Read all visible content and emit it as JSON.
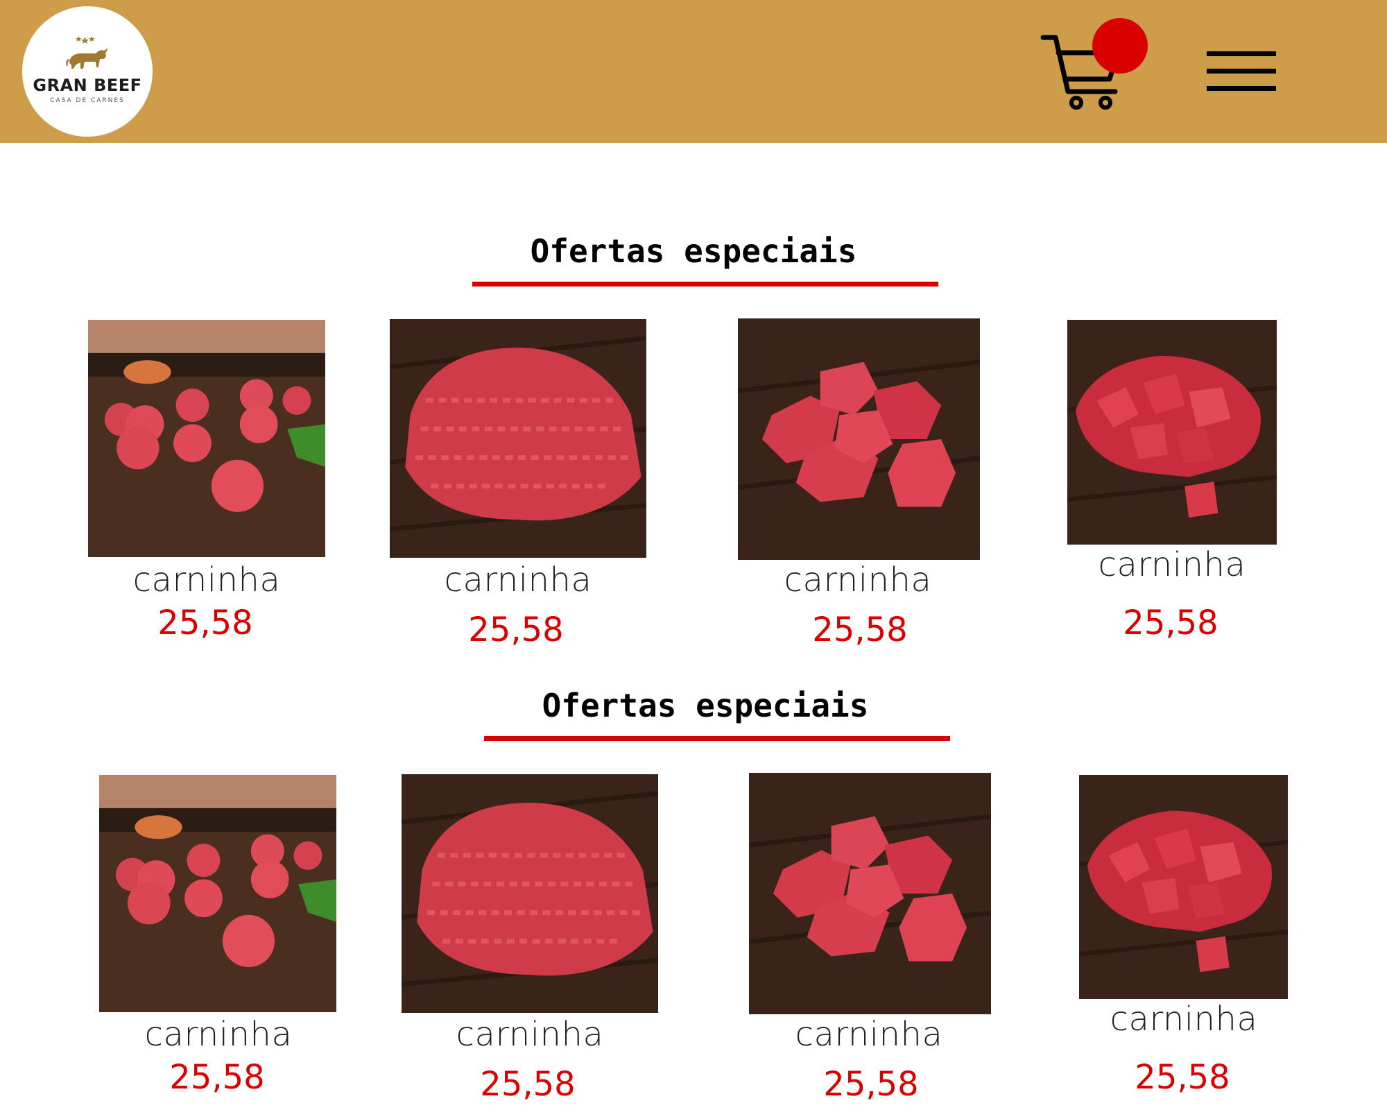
{
  "brand": {
    "name": "GRAN BEEF",
    "tagline": "CASA DE CARNES"
  },
  "colors": {
    "header": "#cd9d4a",
    "accent": "#d90000",
    "text": "#222222"
  },
  "header": {
    "cart_icon": "shopping-cart-icon",
    "menu_icon": "hamburger-menu-icon"
  },
  "sections": [
    {
      "title": "Ofertas especiais",
      "products": [
        {
          "name": "carninha",
          "price": "25,58",
          "image": "meatballs"
        },
        {
          "name": "carninha",
          "price": "25,58",
          "image": "ground-beef"
        },
        {
          "name": "carninha",
          "price": "25,58",
          "image": "beef-cubes"
        },
        {
          "name": "carninha",
          "price": "25,58",
          "image": "diced-beef"
        }
      ]
    },
    {
      "title": "Ofertas especiais",
      "products": [
        {
          "name": "carninha",
          "price": "25,58",
          "image": "meatballs"
        },
        {
          "name": "carninha",
          "price": "25,58",
          "image": "ground-beef"
        },
        {
          "name": "carninha",
          "price": "25,58",
          "image": "beef-cubes"
        },
        {
          "name": "carninha",
          "price": "25,58",
          "image": "diced-beef"
        }
      ]
    }
  ]
}
